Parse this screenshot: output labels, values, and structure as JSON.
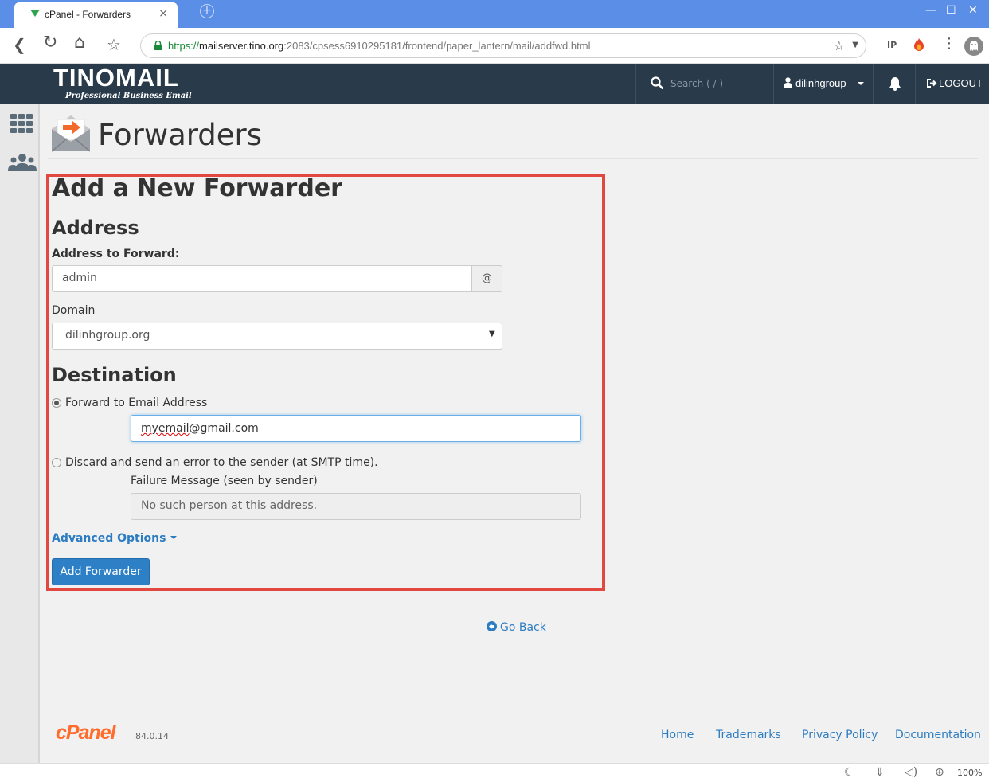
{
  "browser": {
    "tab_title": "cPanel - Forwarders",
    "tab_close": "×",
    "new_tab": "+",
    "minimize": "—",
    "maximize": "☐",
    "close": "✕",
    "url_protocol": "https://",
    "url_host": "mailserver.tino.org",
    "url_rest": ":2083/cpsess6910295181/frontend/paper_lantern/mail/addfwd.html",
    "back": "❮",
    "reload": "↻",
    "home": "⌂",
    "bookmark": "☆",
    "ext_ip": "IP",
    "menu": "⋮",
    "zoom": "100%"
  },
  "topnav": {
    "logo": "TINOMAIL",
    "logo_sub": "Professional Business Email",
    "search_placeholder": "Search ( / )",
    "username": "dilinhgroup",
    "logout": "LOGOUT"
  },
  "page": {
    "title": "Forwarders"
  },
  "form": {
    "heading": "Add a New Forwarder",
    "address_section": "Address",
    "address_label": "Address to Forward:",
    "address_value": "admin",
    "at_symbol": "@",
    "domain_label": "Domain",
    "domain_value": "dilinhgroup.org",
    "destination_section": "Destination",
    "forward_option": "Forward to Email Address",
    "forward_email_prefix": "myemail",
    "forward_email_suffix": "@gmail.com",
    "discard_option": "Discard and send an error to the sender (at SMTP time).",
    "failure_label": "Failure Message (seen by sender)",
    "failure_value": "No such person at this address.",
    "advanced_options": "Advanced Options",
    "submit": "Add Forwarder"
  },
  "go_back": "Go Back",
  "footer": {
    "logo": "cPanel",
    "version": "84.0.14",
    "links": [
      "Home",
      "Trademarks",
      "Privacy Policy",
      "Documentation"
    ]
  },
  "colors": {
    "accent": "#2c7cc2",
    "highlight": "#e04840",
    "navbar": "#293a4a",
    "cpanel_orange": "#ff6c2c"
  }
}
